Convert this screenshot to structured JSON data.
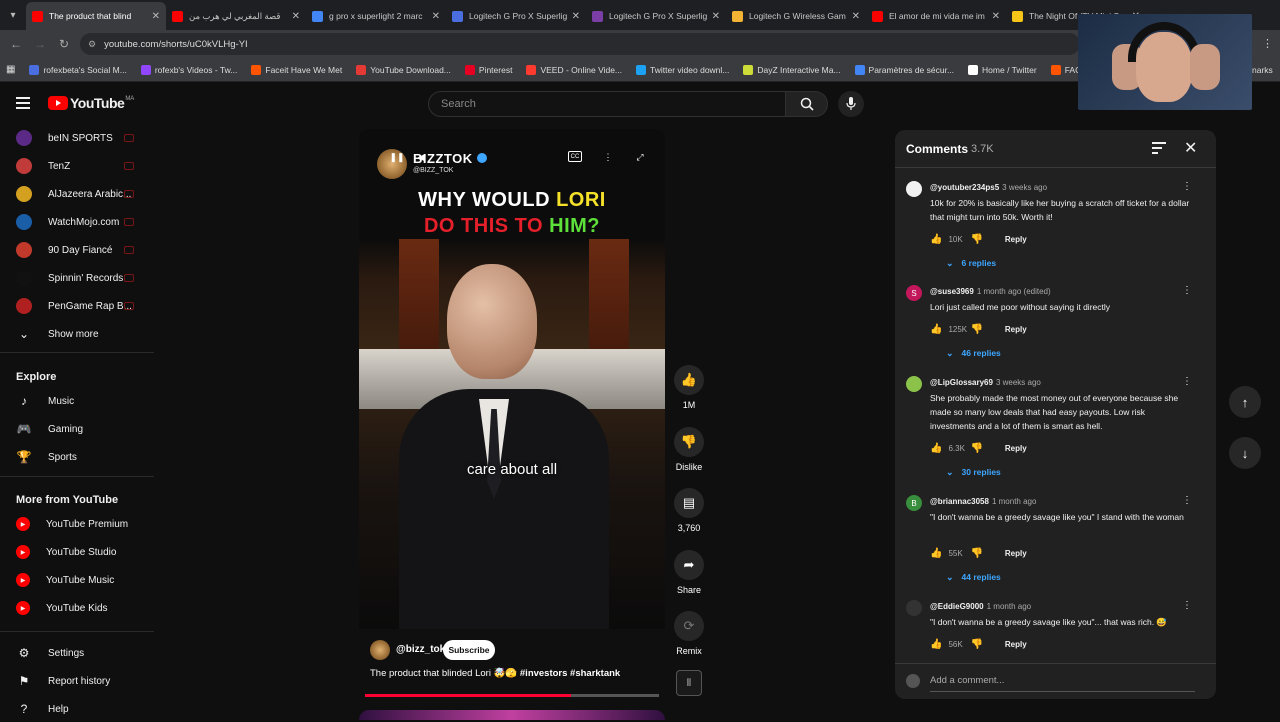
{
  "browser": {
    "tabs": [
      {
        "title": "The product that blind",
        "color": "#ff0000",
        "active": true
      },
      {
        "title": "قصة المغربي لي هرب من",
        "color": "#ff0000"
      },
      {
        "title": "g pro x superlight 2 marc",
        "color": "#4285f4"
      },
      {
        "title": "Logitech G Pro X Superlig",
        "color": "#4a6ee0"
      },
      {
        "title": "Logitech G Pro X Superlig",
        "color": "#7a3ea6"
      },
      {
        "title": "Logitech G Wireless Gam",
        "color": "#f2b233"
      },
      {
        "title": "El amor de mi vida me im",
        "color": "#ff0000"
      },
      {
        "title": "The Night Of (TV Mini Se",
        "color": "#f5c518"
      }
    ],
    "url": "youtube.com/shorts/uC0kVLHg-YI",
    "bookmarks": [
      {
        "label": "rofexbeta's Social M...",
        "color": "#4a6ee0"
      },
      {
        "label": "rofexb's Videos - Tw...",
        "color": "#9146ff"
      },
      {
        "label": "Faceit Have We Met",
        "color": "#ff5500"
      },
      {
        "label": "YouTube Download...",
        "color": "#e53935"
      },
      {
        "label": "Pinterest",
        "color": "#e60023"
      },
      {
        "label": "VEED - Online Vide...",
        "color": "#ff3b30"
      },
      {
        "label": "Twitter video downl...",
        "color": "#1da1f2"
      },
      {
        "label": "DayZ Interactive Ma...",
        "color": "#cddc39"
      },
      {
        "label": "Paramètres de sécur...",
        "color": "#4285f4"
      },
      {
        "label": "Home / Twitter",
        "color": "#ffffff"
      },
      {
        "label": "FACEIT competitive...",
        "color": "#ff5500"
      }
    ],
    "bookmarks_overflow": "narks"
  },
  "youtube": {
    "logo_text": "YouTube",
    "logo_country": "MA",
    "search_placeholder": "Search"
  },
  "sidebar": {
    "subscriptions": [
      {
        "label": "beIN SPORTS",
        "color": "#5b2a86"
      },
      {
        "label": "TenZ",
        "color": "#c23b3b"
      },
      {
        "label": "AlJazeera Arabic...",
        "color": "#d4a020"
      },
      {
        "label": "WatchMojo.com",
        "color": "#1a5ea8"
      },
      {
        "label": "90 Day Fiancé",
        "color": "#c0392b"
      },
      {
        "label": "Spinnin' Records",
        "color": "#111111"
      },
      {
        "label": "PenGame Rap B...",
        "color": "#b02020"
      }
    ],
    "show_more": "Show more",
    "explore_heading": "Explore",
    "explore": [
      {
        "label": "Music",
        "icon": "music-note-icon",
        "glyph": "♪"
      },
      {
        "label": "Gaming",
        "icon": "gamepad-icon",
        "glyph": "🎮"
      },
      {
        "label": "Sports",
        "icon": "trophy-icon",
        "glyph": "🏆"
      }
    ],
    "more_heading": "More from YouTube",
    "more": [
      {
        "label": "YouTube Premium",
        "color": "#ff0000"
      },
      {
        "label": "YouTube Studio",
        "color": "#ff0000"
      },
      {
        "label": "YouTube Music",
        "color": "#ff0000"
      },
      {
        "label": "YouTube Kids",
        "color": "#ff0000"
      }
    ],
    "bottom": [
      {
        "label": "Settings",
        "glyph": "⚙"
      },
      {
        "label": "Report history",
        "glyph": "⚑"
      },
      {
        "label": "Help",
        "glyph": "?"
      }
    ]
  },
  "short": {
    "overlay_channel": "BIZZTOK",
    "overlay_handle": "@BIZZ_TOK",
    "caption_line1_white": "WHY WOULD ",
    "caption_line1_yellow": "LORI",
    "caption_line2_red": "DO THIS TO ",
    "caption_line2_green": "HIM?",
    "subtitle": "care about all",
    "channel": "@bizz_tok",
    "subscribe": "Subscribe",
    "title": "The product that blinded Lori 🤯🫣",
    "hashtags": "#investors #sharktank",
    "progress_fraction": 0.7
  },
  "actions": {
    "likes": "1M",
    "dislike": "Dislike",
    "comments": "3,760",
    "share": "Share",
    "remix": "Remix"
  },
  "comments_panel": {
    "title": "Comments",
    "count": "3.7K",
    "items": [
      {
        "author": "@youtuber234ps5",
        "time": "3 weeks ago",
        "text": "10k for 20% is basically like her buying a scratch off ticket for a dollar that might turn into 50k. Worth it!",
        "likes": "10K",
        "replies": "6 replies",
        "avatar_color": "#f1f1f1",
        "initial": ""
      },
      {
        "author": "@suse3969",
        "time": "1 month ago (edited)",
        "text": "Lori just called me poor without saying it directly",
        "likes": "125K",
        "replies": "46 replies",
        "avatar_color": "#c2185b",
        "initial": "S"
      },
      {
        "author": "@LipGlossary69",
        "time": "3 weeks ago",
        "text": "She probably made the most money out of everyone because she made so many low deals that had easy payouts. Low risk investments and a lot of them is smart as hell.",
        "likes": "6.3K",
        "replies": "30 replies",
        "avatar_color": "#8bc34a",
        "initial": ""
      },
      {
        "author": "@briannac3058",
        "time": "1 month ago",
        "text": "\"I don't wanna be a greedy savage like you\" I stand with the woman",
        "likes": "55K",
        "replies": "44 replies",
        "avatar_color": "#388e3c",
        "initial": "B"
      },
      {
        "author": "@EddieG9000",
        "time": "1 month ago",
        "text": "\"I don't wanna be a greedy savage like you\"... that was rich. 😅",
        "likes": "56K",
        "replies": "",
        "avatar_color": "#333333",
        "initial": ""
      }
    ],
    "reply_label": "Reply",
    "add_placeholder": "Add a comment..."
  }
}
